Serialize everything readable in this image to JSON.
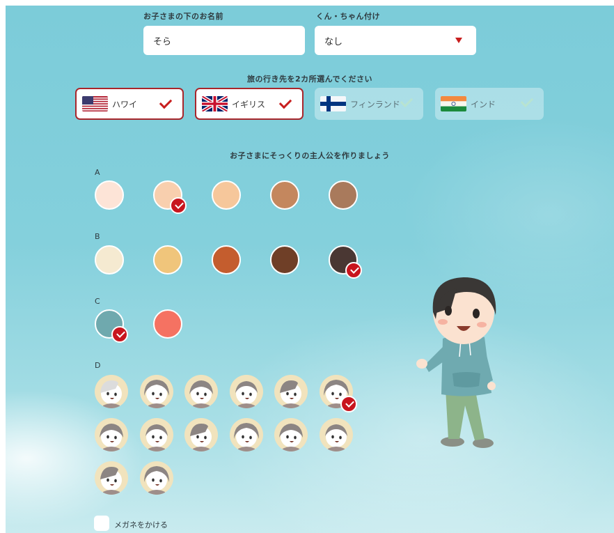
{
  "form": {
    "name_label": "お子さまの下のお名前",
    "name_value": "そら",
    "honorific_label": "くん・ちゃん付け",
    "honorific_value": "なし"
  },
  "destinations": {
    "title": "旅の行き先を2カ所選んでください",
    "items": [
      {
        "label": "ハワイ",
        "selected": true
      },
      {
        "label": "イギリス",
        "selected": true
      },
      {
        "label": "フィンランド",
        "selected": false
      },
      {
        "label": "インド",
        "selected": false
      }
    ]
  },
  "character": {
    "title": "お子さまにそっくりの主人公を作りましょう",
    "group_a": {
      "label": "A",
      "colors": [
        "#fde4d7",
        "#f8cfae",
        "#f6c79b",
        "#c4875e",
        "#a97a5c"
      ],
      "selected": 1
    },
    "group_b": {
      "label": "B",
      "colors": [
        "#f5ead1",
        "#f0c57b",
        "#c45d2e",
        "#6f3f27",
        "#4a3733"
      ],
      "selected": 4
    },
    "group_c": {
      "label": "C",
      "colors": [
        "#6fa9ae",
        "#f57262"
      ],
      "selected": 0
    },
    "group_d": {
      "label": "D",
      "styles": 14,
      "selected": 5
    },
    "glasses_label": "メガネをかける"
  },
  "colors": {
    "accent": "#c8151e",
    "border_selected": "#a8262b"
  }
}
